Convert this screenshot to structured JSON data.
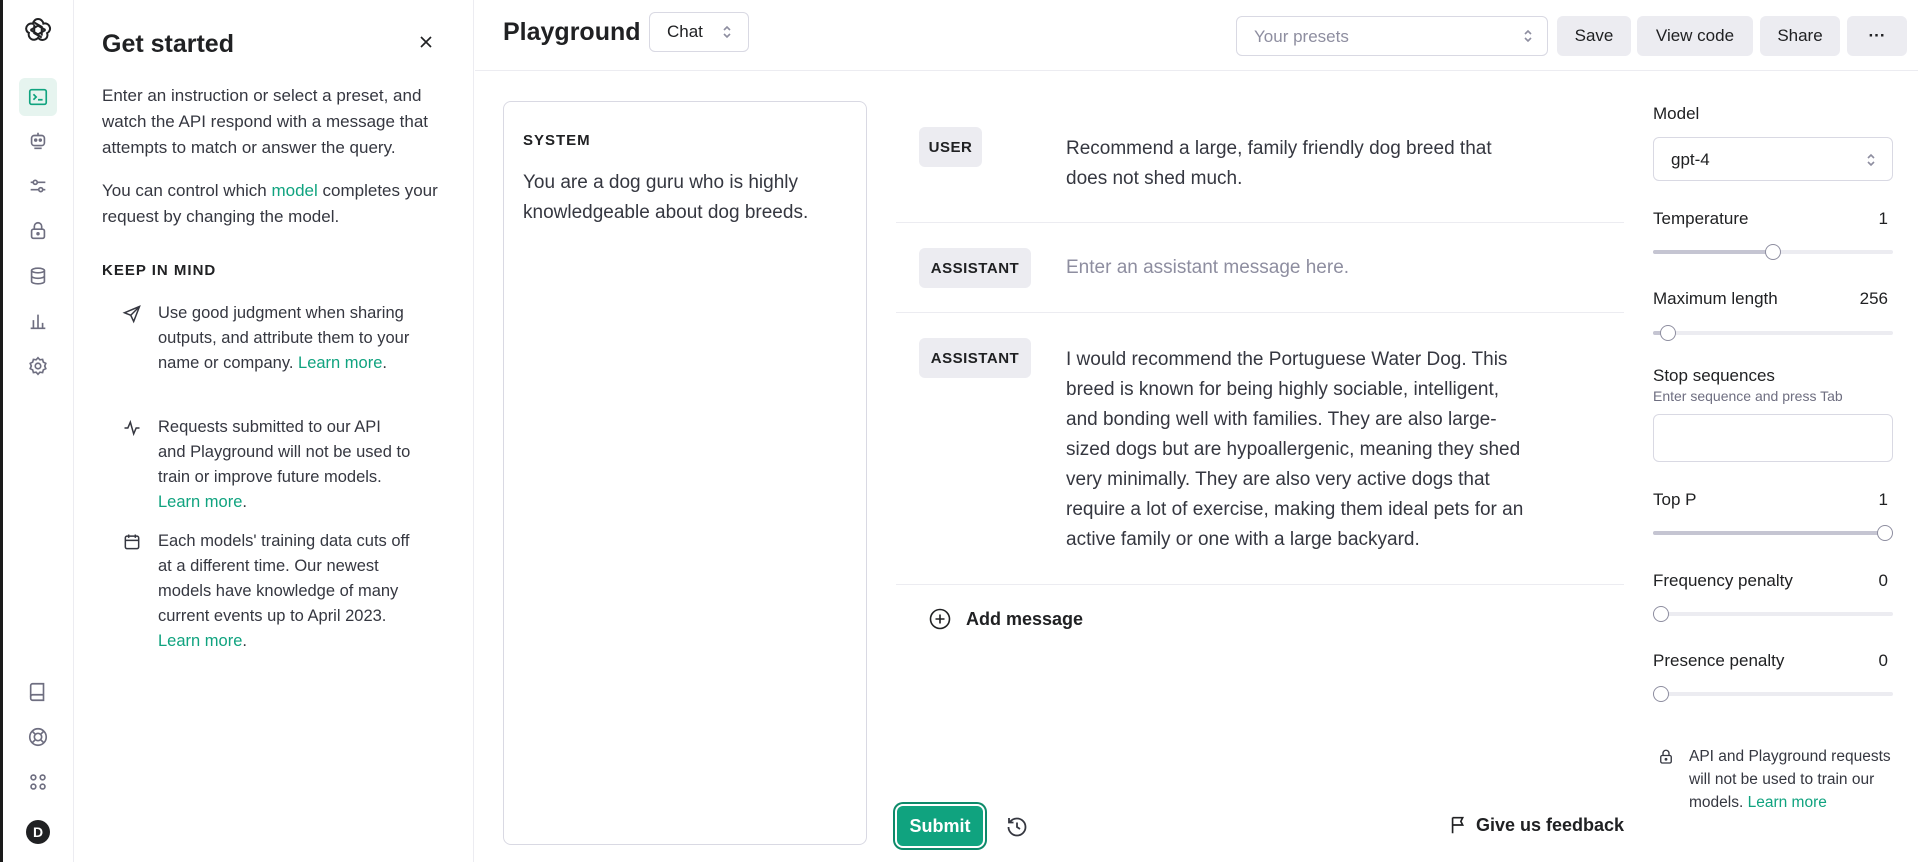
{
  "app": {
    "title": "Playground",
    "mode": "Chat",
    "avatar_initial": "D"
  },
  "rail": {
    "icons": [
      "openai-logo-icon",
      "terminal-icon",
      "assistant-bot-icon",
      "sliders-icon",
      "lock-icon",
      "database-icon",
      "bar-chart-icon",
      "settings-icon",
      "book-icon",
      "lifebuoy-icon",
      "apps-grid-icon"
    ]
  },
  "guide": {
    "title": "Get started",
    "intro": "Enter an instruction or select a preset, and watch the API respond with a message that attempts to match or answer the query.",
    "intro2_prefix": "You can control which ",
    "intro2_link": "model",
    "intro2_suffix": " completes your request by changing the model.",
    "keep_in_mind": "KEEP IN MIND",
    "tips": [
      {
        "text": "Use good judgment when sharing outputs, and attribute them to your name or company. ",
        "link": "Learn more",
        "icon": "send-icon"
      },
      {
        "text": "Requests submitted to our API and Playground will not be used to train or improve future models. ",
        "link": "Learn more",
        "icon": "activity-icon"
      },
      {
        "text": "Each models' training data cuts off at a different time. Our newest models have knowledge of many current events up to April 2023. ",
        "link": "Learn more",
        "icon": "calendar-icon"
      }
    ]
  },
  "header": {
    "presets_placeholder": "Your presets",
    "save": "Save",
    "view_code": "View code",
    "share": "Share",
    "more": "···"
  },
  "system": {
    "label": "SYSTEM",
    "text": "You are a dog guru who is highly knowledgeable about dog breeds."
  },
  "messages": [
    {
      "role": "USER",
      "content": "Recommend a large, family friendly dog breed that does not shed much."
    },
    {
      "role": "ASSISTANT",
      "placeholder": "Enter an assistant message here."
    },
    {
      "role": "ASSISTANT",
      "content": "I would recommend the Portuguese Water Dog. This breed is known for being highly sociable, intelligent, and bonding well with families. They are also large-sized dogs but are hypoallergenic, meaning they shed very minimally. They are also very active dogs that require a lot of exercise, making them ideal pets for an active family or one with a large backyard."
    }
  ],
  "composer": {
    "add_message": "Add message",
    "submit": "Submit",
    "feedback": "Give us feedback"
  },
  "settings": {
    "model_label": "Model",
    "model_value": "gpt-4",
    "temperature": {
      "label": "Temperature",
      "value": "1",
      "min": 0,
      "max": 2,
      "current": 1
    },
    "max_length": {
      "label": "Maximum length",
      "value": "256",
      "min": 1,
      "max": 8192,
      "current": 256
    },
    "stop_sequences": {
      "label": "Stop sequences",
      "hint": "Enter sequence and press Tab"
    },
    "top_p": {
      "label": "Top P",
      "value": "1",
      "min": 0,
      "max": 1,
      "current": 1
    },
    "frequency_penalty": {
      "label": "Frequency penalty",
      "value": "0",
      "min": 0,
      "max": 2,
      "current": 0
    },
    "presence_penalty": {
      "label": "Presence penalty",
      "value": "0",
      "min": 0,
      "max": 2,
      "current": 0
    },
    "notice_text": "API and Playground requests will not be used to train our models. ",
    "notice_link": "Learn more"
  },
  "colors": {
    "accent": "#10a37f",
    "text": "#202123",
    "muted": "#8e8ea0",
    "chip_bg": "#ececf1",
    "border": "#d9d9e3"
  }
}
